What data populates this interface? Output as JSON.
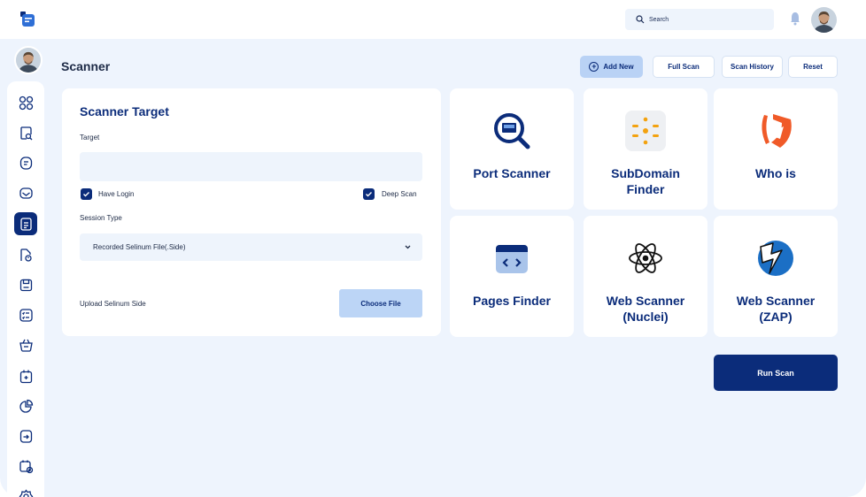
{
  "header": {
    "search_placeholder": "Search"
  },
  "page": {
    "title": "Scanner"
  },
  "actions": {
    "add_new": "Add New",
    "full_scan": "Full Scan",
    "scan_history": "Scan History",
    "reset": "Reset"
  },
  "sidebar": {
    "items": [
      {
        "icon": "dashboard-icon",
        "active": false
      },
      {
        "icon": "search-doc-icon",
        "active": false
      },
      {
        "icon": "document-icon",
        "active": false
      },
      {
        "icon": "mail-icon",
        "active": false
      },
      {
        "icon": "scanner-doc-icon",
        "active": true
      },
      {
        "icon": "report-icon",
        "active": false
      },
      {
        "icon": "save-icon",
        "active": false
      },
      {
        "icon": "checklist-icon",
        "active": false
      },
      {
        "icon": "basket-icon",
        "active": false
      },
      {
        "icon": "calendar-plus-icon",
        "active": false
      },
      {
        "icon": "pie-chart-icon",
        "active": false
      },
      {
        "icon": "export-icon",
        "active": false
      },
      {
        "icon": "calendar-add-icon",
        "active": false
      },
      {
        "icon": "settings-icon",
        "active": false
      }
    ]
  },
  "target_form": {
    "title": "Scanner Target",
    "target_label": "Target",
    "target_value": "",
    "have_login_label": "Have Login",
    "have_login_checked": true,
    "deep_scan_label": "Deep Scan",
    "deep_scan_checked": true,
    "session_type_label": "Session Type",
    "session_type_value": "Recorded Selinum File(.Side)",
    "upload_label": "Upload Selinum Side",
    "choose_file": "Choose File"
  },
  "tools": [
    {
      "name": "Port Scanner",
      "icon": "port-scanner-icon"
    },
    {
      "name": "SubDomain\nFinder",
      "icon": "subdomain-finder-icon"
    },
    {
      "name": "Who is",
      "icon": "whois-icon"
    },
    {
      "name": "Pages Finder",
      "icon": "pages-finder-icon"
    },
    {
      "name": "Web Scanner\n(Nuclei)",
      "icon": "atom-icon"
    },
    {
      "name": "Web Scanner\n(ZAP)",
      "icon": "zap-icon"
    }
  ],
  "run_scan": "Run Scan",
  "colors": {
    "primary": "#0b2c7a",
    "background": "#eef4fd",
    "accent_soft": "#b9d2f5"
  }
}
